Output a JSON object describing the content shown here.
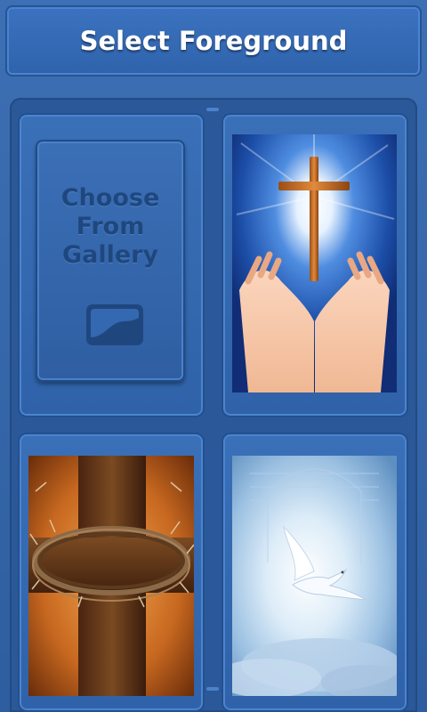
{
  "header": {
    "title": "Select Foreground"
  },
  "gallery": {
    "lines": [
      "Choose",
      "From",
      "Gallery"
    ],
    "icon": "picture-icon"
  },
  "foregrounds": [
    {
      "name": "cross-light-hands",
      "icon": "cross-hands-image"
    },
    {
      "name": "cross-crown-of-thorns",
      "icon": "cross-thorns-image"
    },
    {
      "name": "dove-light",
      "icon": "dove-image"
    }
  ],
  "colors": {
    "background": "#2e5e9f",
    "header": "#3b72bf",
    "gallery_text": "#1f477e"
  }
}
